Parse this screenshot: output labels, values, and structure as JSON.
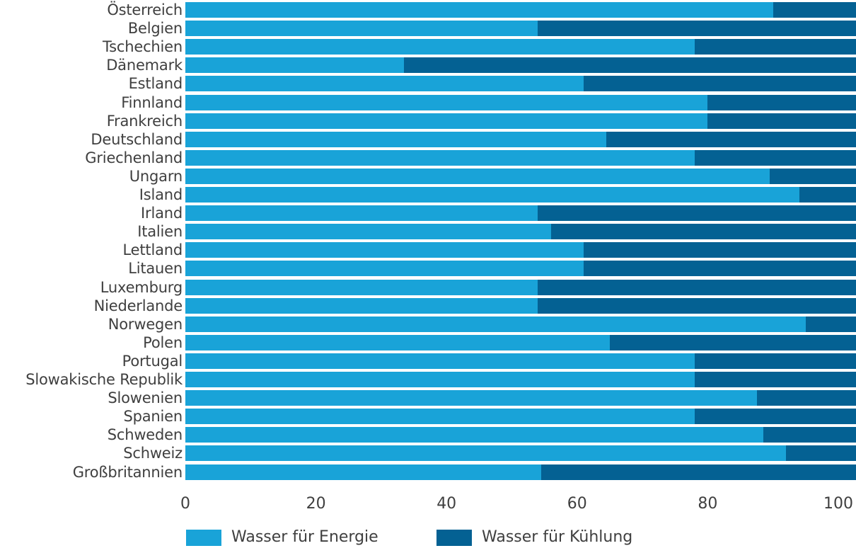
{
  "chart_data": {
    "type": "bar",
    "orientation": "horizontal",
    "stacked": true,
    "title": "",
    "subtitle": "",
    "xlabel": "",
    "ylabel": "",
    "xlim": [
      0,
      103
    ],
    "xticks": [
      0,
      20,
      40,
      60,
      80,
      100
    ],
    "xtick_labels": [
      "0",
      "20",
      "40",
      "60",
      "80",
      "100"
    ],
    "grid": false,
    "legend_position": "bottom",
    "colors": {
      "energy": "#19a3d8",
      "cooling": "#046193",
      "text": "#3f3f3f",
      "background": "#ffffff"
    },
    "categories": [
      "Österreich",
      "Belgien",
      "Tschechien",
      "Dänemark",
      "Estland",
      "Finnland",
      "Frankreich",
      "Deutschland",
      "Griechenland",
      "Ungarn",
      "Island",
      "Irland",
      "Italien",
      "Lettland",
      "Litauen",
      "Luxemburg",
      "Niederlande",
      "Norwegen",
      "Polen",
      "Portugal",
      "Slowakische Republik",
      "Slowenien",
      "Spanien",
      "Schweden",
      "Schweiz",
      "Großbritannien"
    ],
    "series": [
      {
        "name": "Wasser für Energie",
        "color": "#19a3d8",
        "values": [
          90,
          54,
          78,
          33.5,
          61,
          80,
          80,
          64.5,
          78,
          89.5,
          94,
          54,
          56,
          61,
          61,
          54,
          54,
          95,
          65,
          78,
          78,
          87.5,
          78,
          88.5,
          92,
          54.5
        ]
      },
      {
        "name": "Wasser für Kühlung",
        "color": "#046193",
        "values": [
          13,
          49,
          25,
          69.5,
          42,
          23,
          23,
          38.5,
          25,
          13.5,
          9,
          49,
          47,
          42,
          42,
          49,
          49,
          8,
          38,
          25,
          25,
          15.5,
          25,
          14.5,
          11,
          48.5
        ]
      }
    ],
    "totals": [
      103,
      103,
      103,
      103,
      103,
      103,
      103,
      103,
      103,
      103,
      103,
      103,
      103,
      103,
      103,
      103,
      103,
      103,
      103,
      103,
      103,
      103,
      103,
      103,
      103,
      103
    ]
  },
  "legend": {
    "items": [
      {
        "label": "Wasser für Energie",
        "color": "#19a3d8"
      },
      {
        "label": "Wasser für Kühlung",
        "color": "#046193"
      }
    ]
  }
}
